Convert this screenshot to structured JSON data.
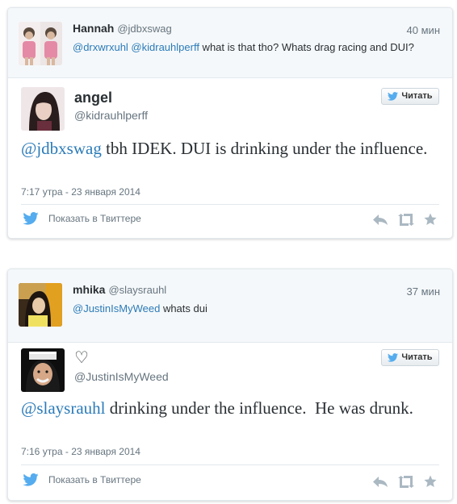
{
  "cards": [
    {
      "context": {
        "name": "Hannah",
        "handle": "@jdbxswag",
        "time": "40 мин",
        "text_mentions": "@drxwrxuhl @kidrauhlperff",
        "text_rest": " what is that tho? Whats drag racing and DUI?"
      },
      "tweet": {
        "name": "angel",
        "handle": "@kidrauhlperff",
        "follow_label": "Читать",
        "text_mention": "@jdbxswag",
        "text_rest": " tbh IDEK. DUI is drinking under the influence.",
        "timestamp": "7:17 утра - 23 января 2014"
      },
      "footer": {
        "view_label": "Показать в Твиттере"
      }
    },
    {
      "context": {
        "name": "mhika",
        "handle": "@slaysrauhl",
        "time": "37 мин",
        "text_mentions": "@JustinIsMyWeed",
        "text_rest": " whats dui"
      },
      "tweet": {
        "name": "♡",
        "handle": "@JustinIsMyWeed",
        "follow_label": "Читать",
        "text_mention": "@slaysrauhl",
        "text_rest": " drinking under the influence.  He was drunk.",
        "timestamp": "7:16 утра - 23 января 2014"
      },
      "footer": {
        "view_label": "Показать в Твиттере"
      }
    }
  ],
  "colors": {
    "link": "#2b7bb9",
    "twitter_blue": "#55acee",
    "muted": "#66757f",
    "action_icon": "#aab8c2"
  },
  "icons": [
    "twitter-bird-icon",
    "reply-icon",
    "retweet-icon",
    "favorite-star-icon"
  ]
}
